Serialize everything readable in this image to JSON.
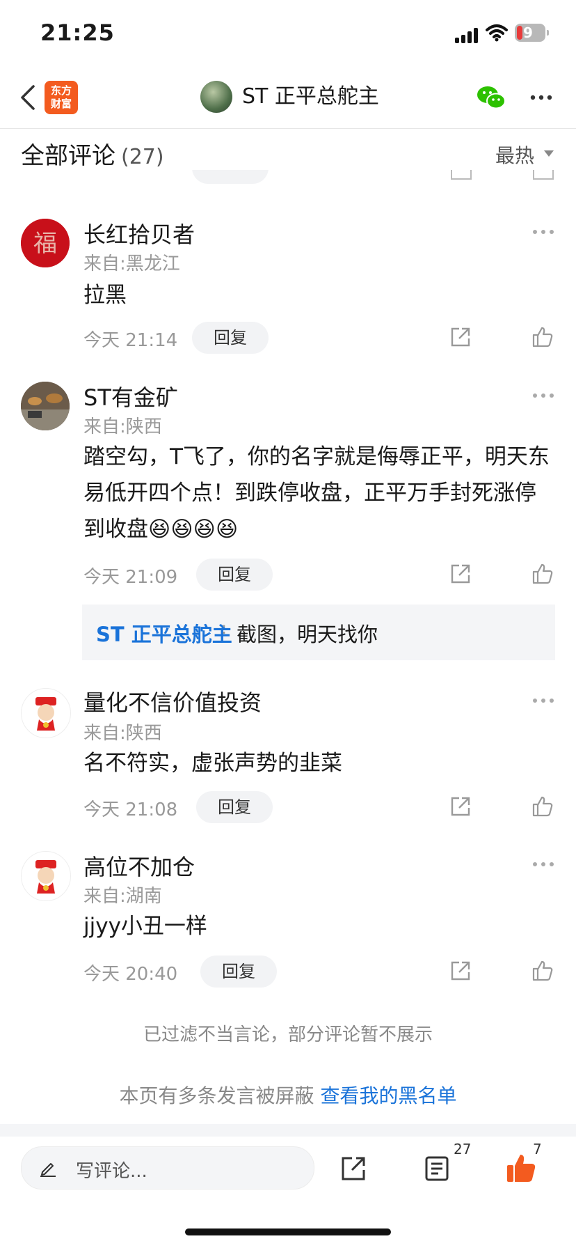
{
  "status_bar": {
    "time": "21:25",
    "battery": "9"
  },
  "nav": {
    "logo_text_1": "东方",
    "logo_text_2": "财富",
    "title": "ST 正平总舵主"
  },
  "header": {
    "title": "全部评论",
    "count": "(27)",
    "sort": "最热"
  },
  "comments": [
    {
      "name": "长红拾贝者",
      "location": "来自:黑龙江",
      "text": "拉黑",
      "time": "今天 21:14",
      "reply_label": "回复"
    },
    {
      "name": "ST有金矿",
      "location": "来自:陕西",
      "text": "踏空勾，T飞了，你的名字就是侮辱正平，明天东易低开四个点！到跌停收盘，正平万手封死涨停到收盘😆😆😆😆",
      "time": "今天 21:09",
      "reply_label": "回复",
      "reply": {
        "author": "ST 正平总舵主",
        "sep": ":",
        "text": "截图，明天找你"
      }
    },
    {
      "name": "量化不信价值投资",
      "location": "来自:陕西",
      "text": "名不符实，虚张声势的韭菜",
      "time": "今天 21:08",
      "reply_label": "回复"
    },
    {
      "name": "高位不加仓",
      "location": "来自:湖南",
      "text": "jjyy小丑一样",
      "time": "今天 20:40",
      "reply_label": "回复"
    }
  ],
  "notes": {
    "filter": "已过滤不当言论，部分评论暂不展示",
    "blacklist_prefix": "本页有多条发言被屏蔽 ",
    "blacklist_link": "查看我的黑名单"
  },
  "bottom_bar": {
    "placeholder": "写评论...",
    "comment_count": "27",
    "like_count": "7"
  },
  "colors": {
    "brand": "#f35b1f",
    "link": "#1a73d9",
    "like": "#f35b1f"
  }
}
